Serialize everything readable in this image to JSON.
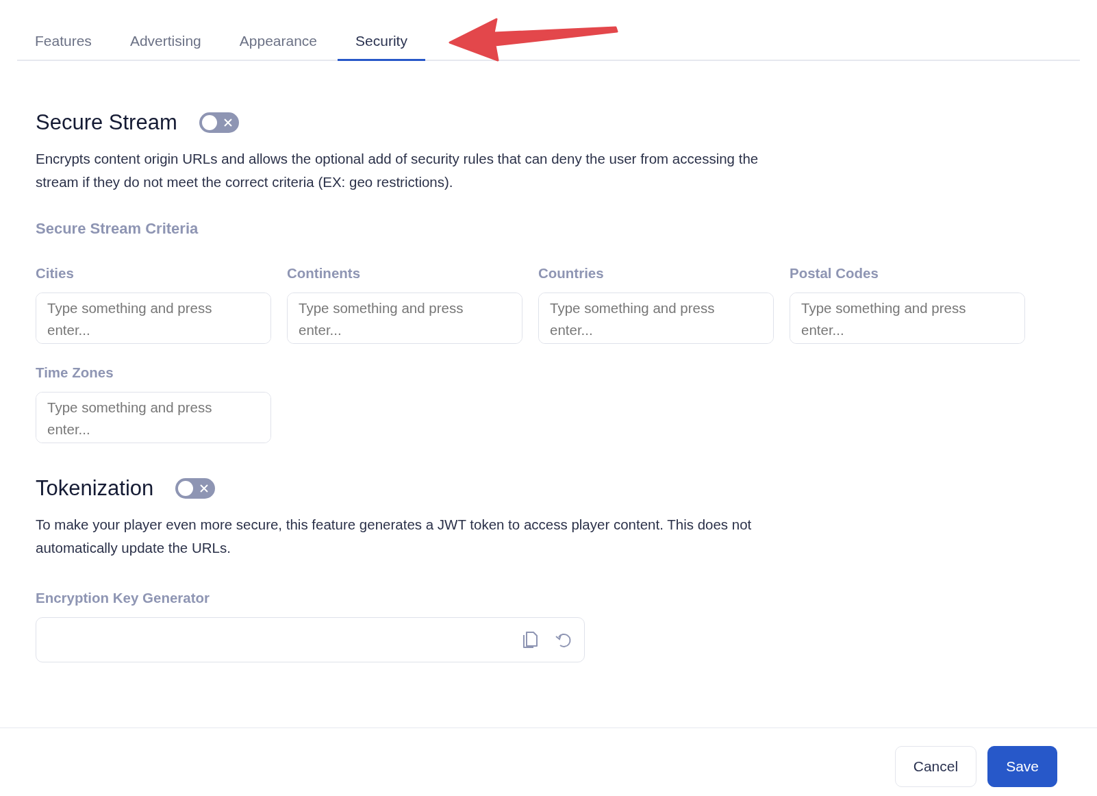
{
  "tabs": [
    {
      "label": "Features",
      "selected": false
    },
    {
      "label": "Advertising",
      "selected": false
    },
    {
      "label": "Appearance",
      "selected": false
    },
    {
      "label": "Security",
      "selected": true
    }
  ],
  "sections": [
    {
      "title": "Secure Stream",
      "on": false,
      "description": "Encrypts content origin URLs and allows the optional add of security rules that can deny the user from accessing the stream if they do not meet the correct criteria (EX: geo restrictions).",
      "subtitle": "Secure Stream Criteria",
      "fields": [
        {
          "label": "Cities",
          "placeholder": "Type something and press enter..."
        },
        {
          "label": "Continents",
          "placeholder": "Type something and press enter..."
        },
        {
          "label": "Countries",
          "placeholder": "Type something and press enter..."
        },
        {
          "label": "Postal Codes",
          "placeholder": "Type something and press enter..."
        },
        {
          "label": "Time Zones",
          "placeholder": "Type something and press enter..."
        }
      ]
    },
    {
      "title": "Tokenization",
      "on": false,
      "description": "To make your player even more secure, this feature generates a JWT token to access player content. This does not automatically update the URLs.",
      "key_field": {
        "label": "Encryption Key Generator"
      }
    }
  ],
  "buttons": [
    {
      "label": "Cancel",
      "kind": "secondary"
    },
    {
      "label": "Save",
      "kind": "primary"
    }
  ]
}
